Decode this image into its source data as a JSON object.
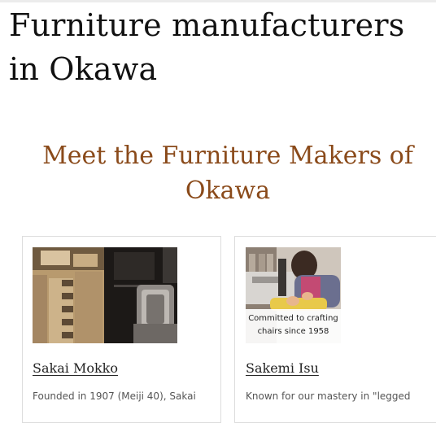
{
  "page": {
    "title": "Furniture manufacturers in Okawa"
  },
  "section": {
    "title": "Meet the Furniture Makers of Okawa"
  },
  "makers": [
    {
      "name": "Sakai Mokko",
      "description": "Founded in 1907 (Meiji 40), Sakai"
    },
    {
      "name": "Sakemi Isu",
      "description": "Known for our mastery in \"legged",
      "image_caption": [
        "Committed to crafting",
        "chairs since 1958"
      ]
    }
  ]
}
